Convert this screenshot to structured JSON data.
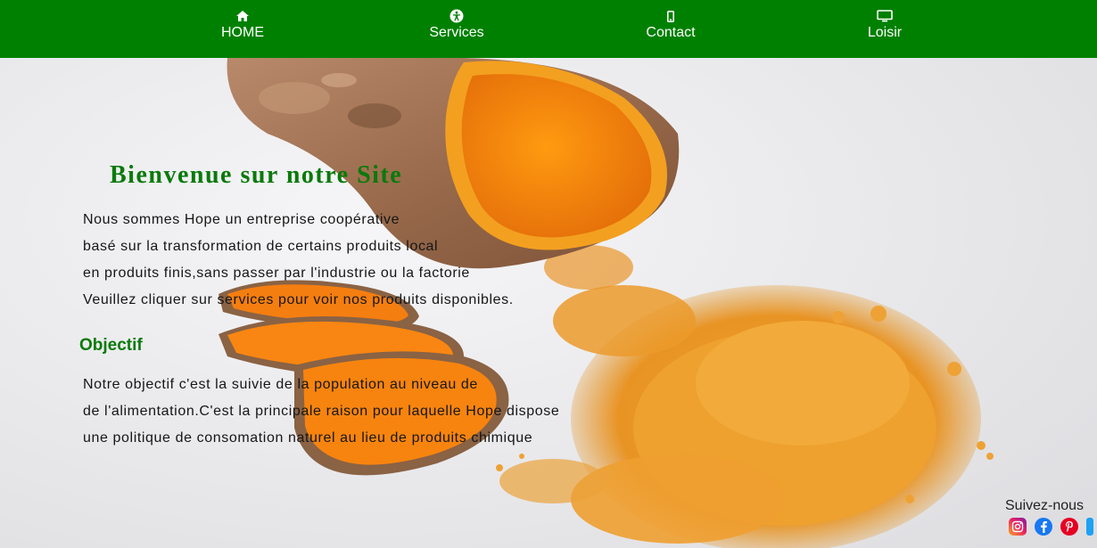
{
  "nav": {
    "items": [
      {
        "label": "HOME",
        "icon": "home-icon"
      },
      {
        "label": "Services",
        "icon": "accessibility-icon"
      },
      {
        "label": "Contact",
        "icon": "mobile-phone-icon"
      },
      {
        "label": "Loisir",
        "icon": "monitor-icon"
      }
    ],
    "bg_color": "#008000"
  },
  "hero": {
    "title": "Bienvenue sur notre Site",
    "intro_lines": [
      "Nous sommes Hope un entreprise coopérative",
      "basé sur la transformation de certains produits local",
      "en produits finis,sans passer par l'industrie ou la factorie",
      "Veuillez cliquer sur services pour voir nos produits disponibles."
    ],
    "objective_heading": "Objectif",
    "objective_lines": [
      "Notre objectif c'est la suivie de la population au niveau de",
      "de l'alimentation.C'est la principale raison pour laquelle Hope dispose",
      "une politique de consomation naturel au lieu de produits chimique"
    ]
  },
  "social": {
    "title": "Suivez-nous",
    "icons": [
      "instagram-icon",
      "facebook-icon",
      "pinterest-icon",
      "twitter-icon"
    ]
  },
  "colors": {
    "accent_green": "#0a7a0a",
    "turmeric_orange": "#f28a12"
  }
}
